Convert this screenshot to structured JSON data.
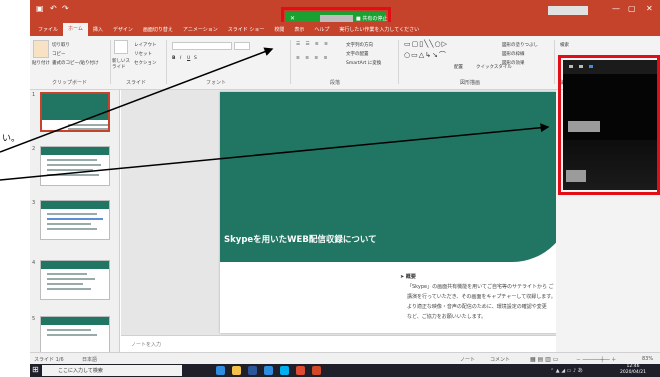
{
  "window": {
    "qat_icons": [
      "save-icon",
      "undo-icon",
      "redo-icon"
    ],
    "controls": [
      "minimize-icon",
      "maximize-icon",
      "close-icon"
    ]
  },
  "recording_bar": {
    "status": "■ 共有の停止"
  },
  "tabs": [
    {
      "label": "ファイル"
    },
    {
      "label": "ホーム",
      "active": true
    },
    {
      "label": "挿入"
    },
    {
      "label": "デザイン"
    },
    {
      "label": "画面切り替え"
    },
    {
      "label": "アニメーション"
    },
    {
      "label": "スライド ショー"
    },
    {
      "label": "校閲"
    },
    {
      "label": "表示"
    },
    {
      "label": "ヘルプ"
    },
    {
      "label": "実行したい作業を入力してください"
    }
  ],
  "ribbon": {
    "clipboard": {
      "paste": "貼り付け",
      "cut": "切り取り",
      "copy": "コピー",
      "format": "書式のコピー/貼り付け",
      "label": "クリップボード"
    },
    "slides": {
      "new_slide": "新しいスライド",
      "layout": "レイアウト",
      "reset": "リセット",
      "section": "セクション",
      "label": "スライド"
    },
    "font": {
      "label": "フォント"
    },
    "paragraph": {
      "text_direction": "文字列の方向",
      "align_text": "文字の配置",
      "smartart": "SmartArt に変換",
      "label": "段落"
    },
    "drawing": {
      "arrange": "配置",
      "quick_styles": "クイックスタイル",
      "shape_fill": "図形の塗りつぶし",
      "shape_outline": "図形の枠線",
      "shape_effects": "図形の効果",
      "label": "図形描画"
    },
    "editing": {
      "find": "検索",
      "label": "編集"
    }
  },
  "slide": {
    "title": "Skypeを用いたWEB配信収録について",
    "bullet_head": "➤ 概要",
    "bullets": [
      "「Skype」の画面共有機能を用いてご自宅等のサテライトから ご",
      "講演を行っていただき、その画面をキャプチャーして収録します。",
      "より適正な映像・音声の配信のために、環境設定の確認や変更",
      "など、ご協力をお願いいたします。"
    ]
  },
  "notes": {
    "placeholder": "ノートを入力"
  },
  "status": {
    "slide_count": "スライド 1/6",
    "language": "日本語",
    "notes_btn": "ノート",
    "comments_btn": "コメント",
    "zoom": "83%"
  },
  "taskbar": {
    "search_placeholder": "ここに入力して検索",
    "time": "12:46",
    "date": "2020/04/21"
  },
  "margin_text": "い。",
  "colors": {
    "accent": "#c4432a",
    "slide_green": "#207563",
    "highlight": "#e30d17",
    "recording_green": "#1aa132"
  }
}
